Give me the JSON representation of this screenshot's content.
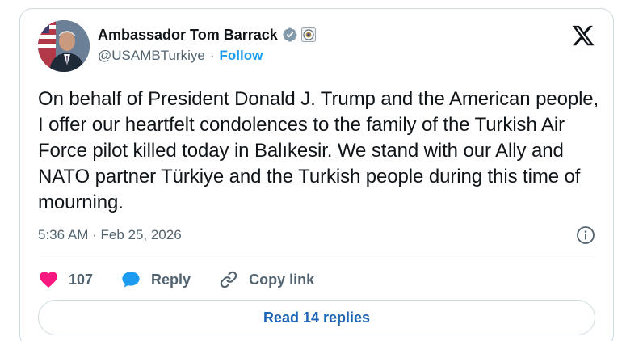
{
  "author": {
    "display_name": "Ambassador Tom Barrack",
    "handle": "@USAMBTurkiye",
    "separator": "·",
    "follow_label": "Follow"
  },
  "tweet": {
    "text": "On behalf of President Donald J. Trump and the American people, I offer our heartfelt condolences to the family of the Turkish Air Force pilot killed today in Balıkesir. We stand with our Ally and NATO partner Türkiye and the Turkish people during this time of mourning.",
    "timestamp": "5:36 AM · Feb 25, 2026"
  },
  "actions": {
    "likes_count": "107",
    "reply_label": "Reply",
    "copy_link_label": "Copy link"
  },
  "read_replies_label": "Read 14 replies",
  "icons": {
    "verified": "verified-badge-icon",
    "seal": "government-seal-icon",
    "platform": "x-logo-icon",
    "info": "info-icon",
    "like": "heart-icon",
    "reply": "speech-bubble-icon",
    "copy_link": "link-icon"
  },
  "colors": {
    "accent": "#1d9bf0",
    "like": "#f91880",
    "text_primary": "#0f1419",
    "text_secondary": "#536471"
  }
}
